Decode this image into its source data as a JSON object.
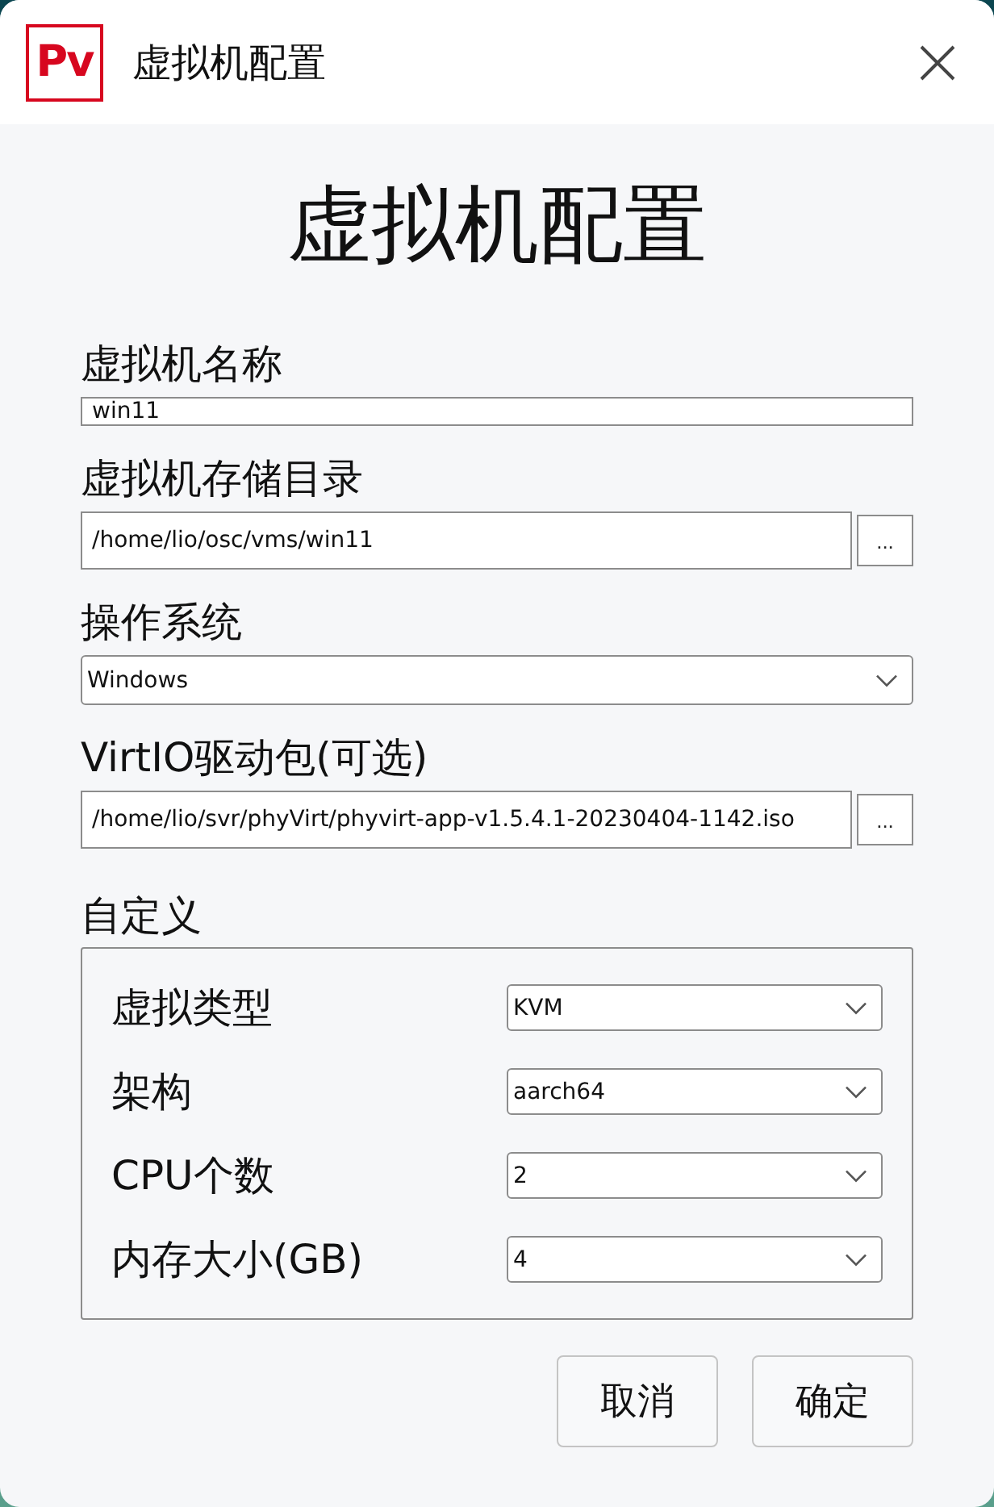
{
  "window": {
    "title": "虚拟机配置",
    "logo": "Pv"
  },
  "heading": "虚拟机配置",
  "fields": [
    {
      "kind": "text",
      "label": "虚拟机名称",
      "value": "win11"
    },
    {
      "kind": "path",
      "label": "虚拟机存储目录",
      "value": "/home/lio/osc/vms/win11",
      "browse": "..."
    },
    {
      "kind": "select",
      "label": "操作系统",
      "value": "Windows"
    },
    {
      "kind": "path",
      "label": "VirtIO驱动包(可选)",
      "value": "/home/lio/svr/phyVirt/phyvirt-app-v1.5.4.1-20230404-1142.iso",
      "browse": "..."
    }
  ],
  "custom": {
    "title": "自定义",
    "rows": [
      {
        "label": "虚拟类型",
        "value": "KVM"
      },
      {
        "label": "架构",
        "value": "aarch64"
      },
      {
        "label": "CPU个数",
        "value": "2"
      },
      {
        "label": "内存大小(GB)",
        "value": "4"
      }
    ]
  },
  "buttons": [
    {
      "label": "取消"
    },
    {
      "label": "确定"
    }
  ]
}
